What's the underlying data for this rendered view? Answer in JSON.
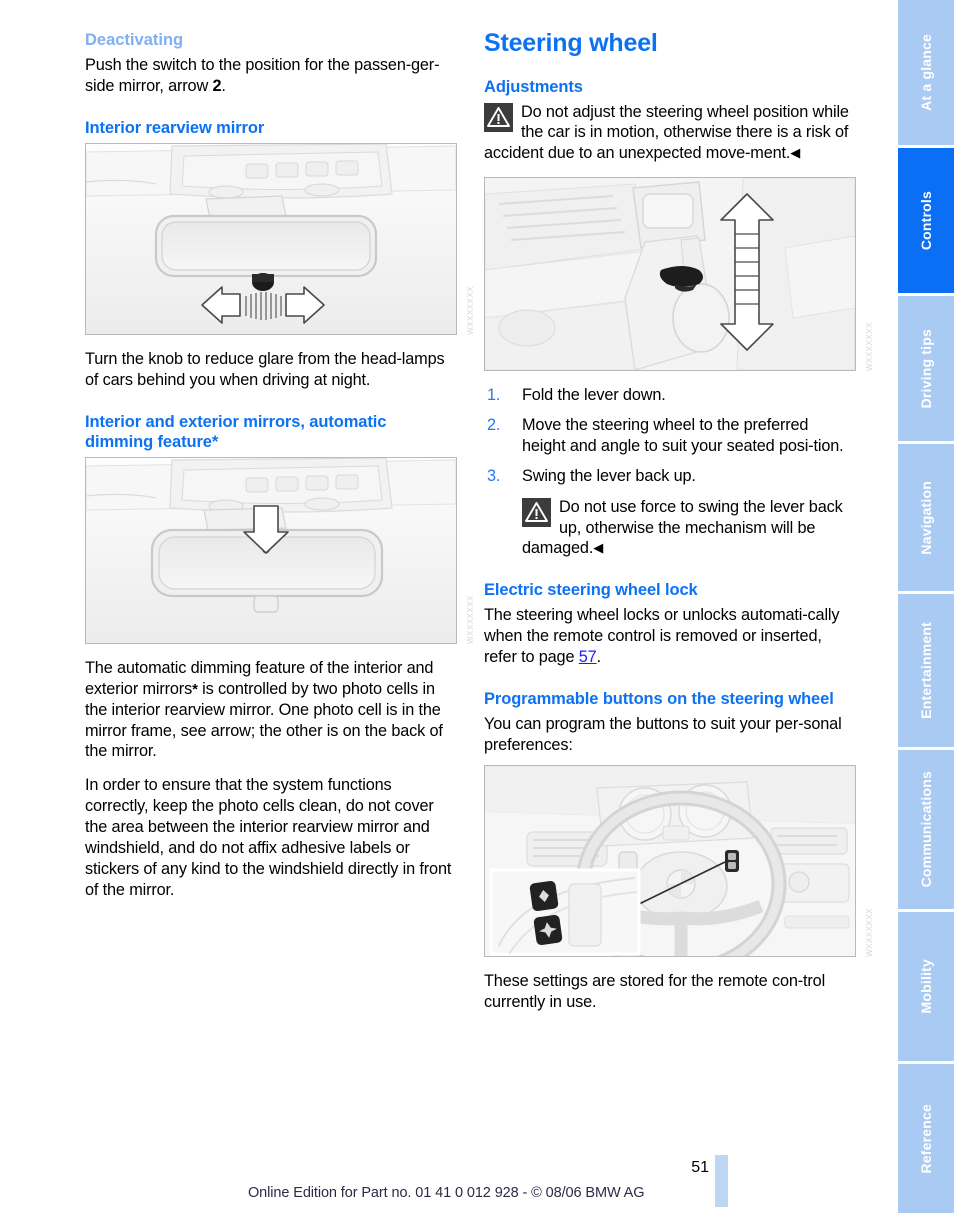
{
  "document": {
    "page_number": "51",
    "footer_note": "Online Edition for Part no. 01 41 0 012 928 - © 08/06 BMW AG"
  },
  "colors": {
    "heading_blue": "#0d72f2",
    "subheading_blue": "#7fb0ef",
    "link_blue": "#1a1aff",
    "tab_blue": "#a9caf3",
    "tab_active_blue": "#0b6ff5",
    "footer_bar_blue": "#bcd6f4"
  },
  "left_column": {
    "sub_heading_deactivating": "Deactivating",
    "deactivating_text_1": "Push the switch to the position for the passen-ger-side mirror, arrow ",
    "deactivating_arrow_number": "2",
    "deactivating_text_2": ".",
    "heading_interior_rearview_mirror": "Interior rearview mirror",
    "figure_1_code": "WXXXXXXX",
    "rearview_text": "Turn the knob to reduce glare from the head-lamps of cars behind you when driving at night.",
    "heading_auto_dimming": "Interior and exterior mirrors, automatic dimming feature*",
    "figure_2_code": "WXXXXXXX",
    "auto_dimming_para_1_a": "The automatic dimming feature of the interior and exterior mirrors",
    "auto_dimming_para_1_star": "*",
    "auto_dimming_para_1_b": " is controlled by two photo cells in the interior rearview mirror. One photo cell is in the mirror frame, see arrow; the other is on the back of the mirror.",
    "auto_dimming_para_2": "In order to ensure that the system functions correctly, keep the photo cells clean, do not cover the area between the interior rearview mirror and windshield, and do not affix adhesive labels or stickers of any kind to the windshield directly in front of the mirror."
  },
  "right_column": {
    "title": "Steering wheel",
    "heading_adjustments": "Adjustments",
    "warning_1": "Do not adjust the steering wheel position while the car is in motion, otherwise there is a risk of accident due to an unexpected move-ment.",
    "warning_1_endmark": "◀",
    "figure_3_code": "WXXXXXXX",
    "steps": [
      "Fold the lever down.",
      "Move the steering wheel to the preferred height and angle to suit your seated posi-tion.",
      "Swing the lever back up."
    ],
    "warning_2": "Do not use force to swing the lever back up, otherwise the mechanism will be damaged.",
    "warning_2_endmark": "◀",
    "heading_electric_lock": "Electric steering wheel lock",
    "electric_lock_text_a": "The steering wheel locks or unlocks automati-cally when the remote control is removed or inserted, refer to page ",
    "electric_lock_page_ref": "57",
    "electric_lock_text_b": ".",
    "heading_programmable_buttons": "Programmable buttons on the steering wheel",
    "programmable_intro": "You can program the buttons to suit your per-sonal preferences:",
    "figure_4_code": "WXXXXXXX",
    "programmable_outro": "These settings are stored for the remote con-trol currently in use."
  },
  "sidebar": {
    "tabs": [
      {
        "label": "At a glance",
        "active": false
      },
      {
        "label": "Controls",
        "active": true
      },
      {
        "label": "Driving tips",
        "active": false
      },
      {
        "label": "Navigation",
        "active": false
      },
      {
        "label": "Entertainment",
        "active": false
      },
      {
        "label": "Communications",
        "active": false
      },
      {
        "label": "Mobility",
        "active": false
      },
      {
        "label": "Reference",
        "active": false
      }
    ]
  }
}
